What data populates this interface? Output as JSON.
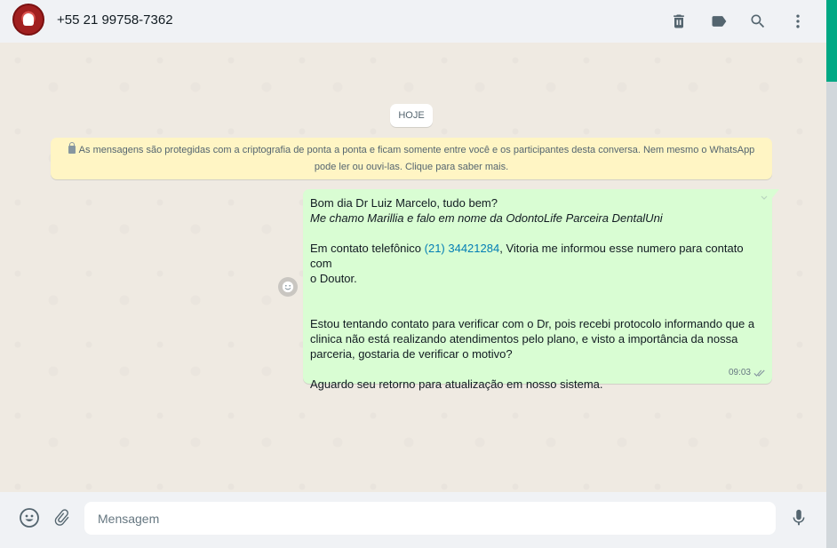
{
  "header": {
    "contact_name": "+55 21 99758-7362",
    "icons": [
      "delete-icon",
      "label-icon",
      "search-icon",
      "menu-icon"
    ]
  },
  "chat": {
    "date_chip": "HOJE",
    "encryption_notice": {
      "line1": "As mensagens são protegidas com a criptografia de ponta a ponta e ficam somente entre você e os participantes desta conversa. Nem mesmo o WhatsApp",
      "line2": "pode ler ou ouvi-las. Clique para saber mais."
    },
    "message": {
      "line1": "Bom dia Dr Luiz Marcelo, tudo bem?",
      "line2": "Me chamo Marillia e falo em nome da OdontoLife Parceira DentalUni",
      "line3_prefix": "Em contato telefônico ",
      "line3_link": "(21) 34421284",
      "line3_suffix": ", Vitoria me informou esse numero para contato com",
      "line4": "o Doutor.",
      "line5": "Estou tentando contato para verificar com o Dr, pois recebi protocolo informando que a",
      "line6": "clinica não está realizando atendimentos pelo plano, e visto a importância da nossa",
      "line7": "parceria, gostaria de verificar o motivo?",
      "line8": "Aguardo seu retorno para atualização em nosso sistema.",
      "time": "09:03",
      "status": "delivered"
    }
  },
  "footer": {
    "input_placeholder": "Mensagem",
    "icons": [
      "emoji-icon",
      "attach-icon",
      "microphone-icon"
    ]
  },
  "colors": {
    "outgoing_bubble": "#d9fdd3",
    "notice_bg": "#fff5c4",
    "link": "#027eb5",
    "accent": "#00a884"
  }
}
